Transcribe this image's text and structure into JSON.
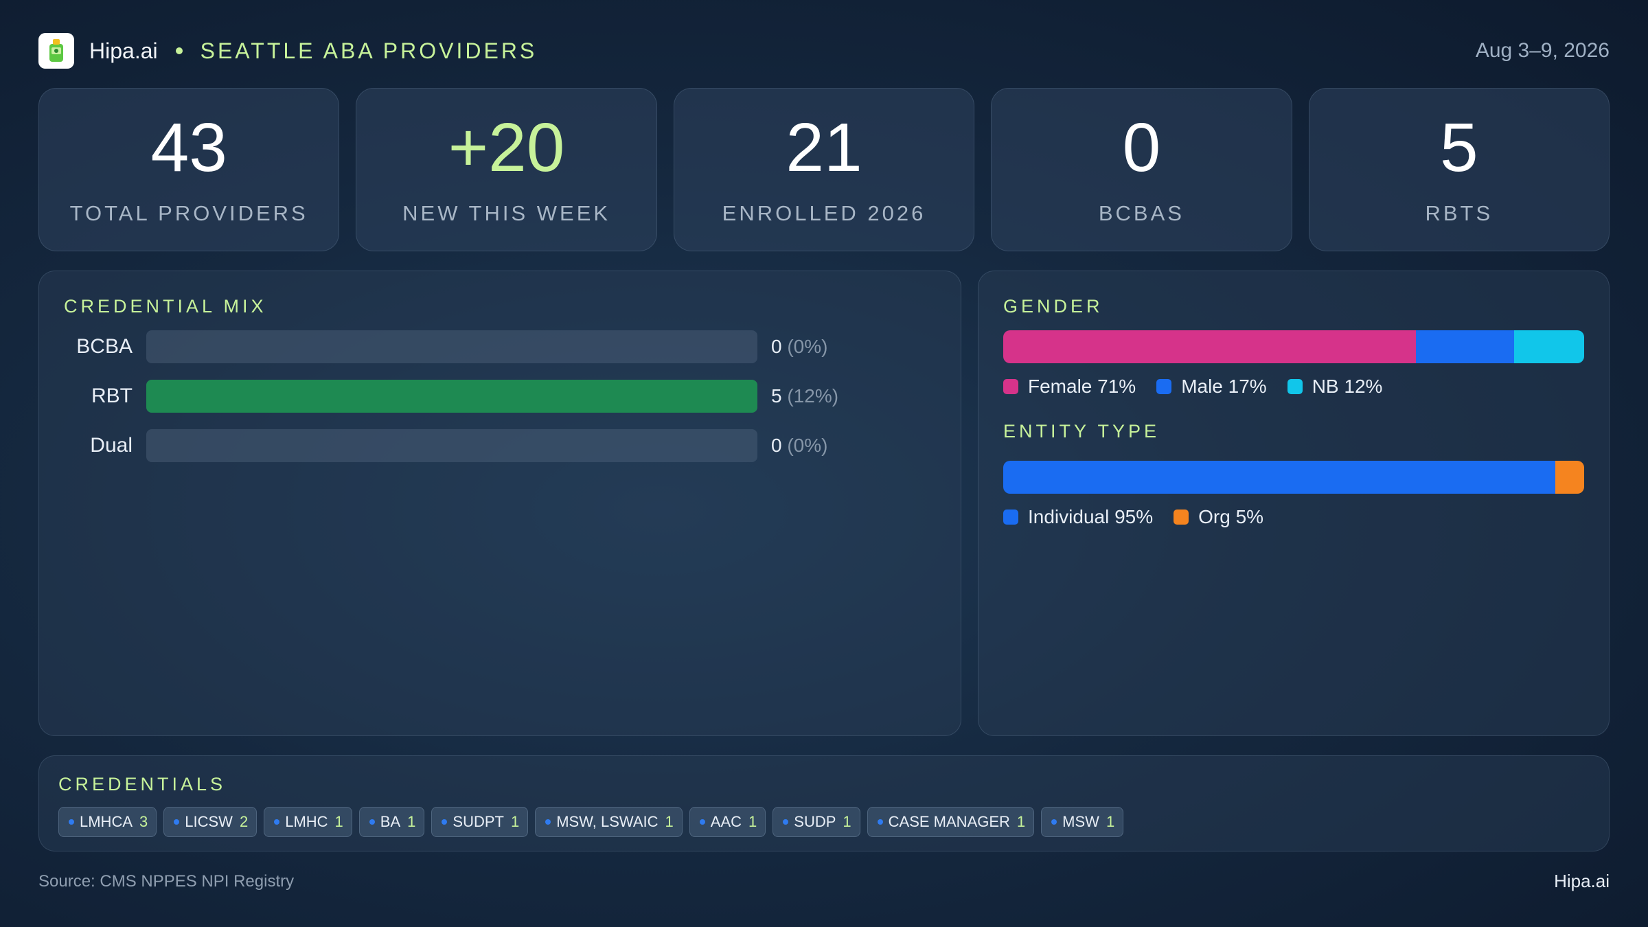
{
  "header": {
    "brand": "Hipa.ai",
    "region": "SEATTLE ABA PROVIDERS",
    "date_range": "Aug 3–9, 2026"
  },
  "stats": [
    {
      "value": "43",
      "label": "TOTAL PROVIDERS"
    },
    {
      "value": "+20",
      "label": "NEW THIS WEEK"
    },
    {
      "value": "21",
      "label": "ENROLLED 2026"
    },
    {
      "value": "0",
      "label": "BCBAS"
    },
    {
      "value": "5",
      "label": "RBTS"
    }
  ],
  "credential_mix": {
    "title": "CREDENTIAL MIX",
    "rows": [
      {
        "label": "BCBA",
        "count": "0",
        "pct": "(0%)",
        "fraction": 0
      },
      {
        "label": "RBT",
        "count": "5",
        "pct": "(12%)",
        "fraction": 1
      },
      {
        "label": "Dual",
        "count": "0",
        "pct": "(0%)",
        "fraction": 0
      }
    ],
    "fill_color": "#1e8a52"
  },
  "gender": {
    "title": "GENDER",
    "segments": [
      {
        "label": "Female 71%",
        "percent": 71,
        "color": "#d6338a"
      },
      {
        "label": "Male 17%",
        "percent": 17,
        "color": "#1a6cf2"
      },
      {
        "label": "NB 12%",
        "percent": 12,
        "color": "#11c6ea"
      }
    ]
  },
  "entity_type": {
    "title": "ENTITY TYPE",
    "segments": [
      {
        "label": "Individual 95%",
        "percent": 95,
        "color": "#1a6cf2"
      },
      {
        "label": "Org 5%",
        "percent": 5,
        "color": "#f5841f"
      }
    ]
  },
  "credentials": {
    "title": "CREDENTIALS",
    "chips": [
      {
        "name": "LMHCA",
        "count": "3"
      },
      {
        "name": "LICSW",
        "count": "2"
      },
      {
        "name": "LMHC",
        "count": "1"
      },
      {
        "name": "BA",
        "count": "1"
      },
      {
        "name": "SUDPT",
        "count": "1"
      },
      {
        "name": "MSW, LSWAIC",
        "count": "1"
      },
      {
        "name": "AAC",
        "count": "1"
      },
      {
        "name": "SUDP",
        "count": "1"
      },
      {
        "name": "CASE MANAGER",
        "count": "1"
      },
      {
        "name": "MSW",
        "count": "1"
      }
    ]
  },
  "footer": {
    "source": "Source: CMS NPPES NPI Registry",
    "brand": "Hipa.ai"
  }
}
